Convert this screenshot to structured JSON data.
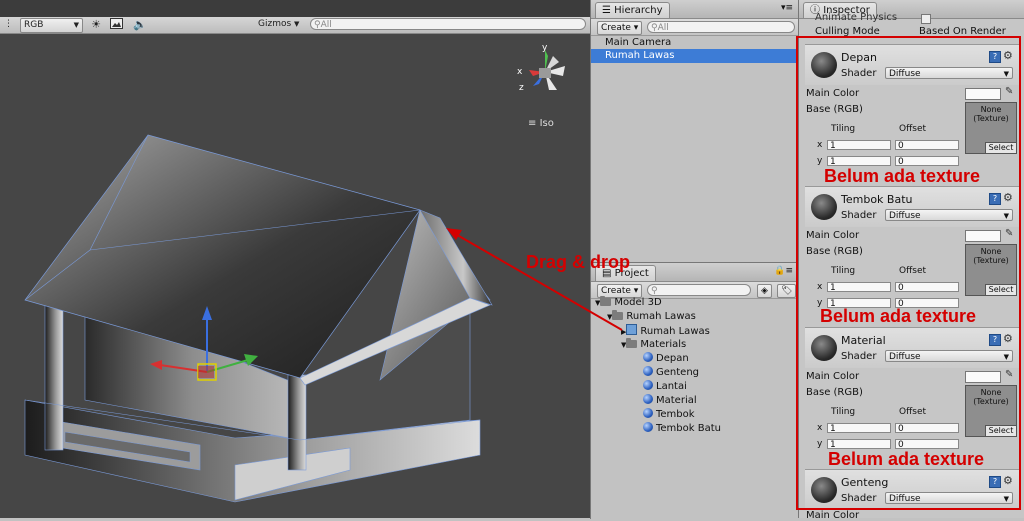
{
  "scene": {
    "render_mode": "RGB",
    "gizmos_label": "Gizmos",
    "search_placeholder": "All",
    "projection_label": "Iso",
    "axis_labels": {
      "x": "x",
      "y": "y",
      "z": "z"
    },
    "icons": [
      "sun-icon",
      "image-icon",
      "audio-icon"
    ]
  },
  "hierarchy": {
    "tab_label": "Hierarchy",
    "create_label": "Create",
    "search_placeholder": "All",
    "items": [
      {
        "label": "Main Camera",
        "selected": false
      },
      {
        "label": "Rumah Lawas",
        "selected": true
      }
    ]
  },
  "project": {
    "tab_label": "Project",
    "create_label": "Create",
    "tree": {
      "root": "Model 3D",
      "child_folder": "Rumah Lawas",
      "prefab": "Rumah Lawas",
      "materials_folder": "Materials",
      "materials": [
        "Depan",
        "Genteng",
        "Lantai",
        "Material",
        "Tembok",
        "Tembok Batu"
      ]
    }
  },
  "inspector": {
    "tab_label": "Inspector",
    "top_rows": [
      {
        "label": "Animate Physics",
        "value": ""
      },
      {
        "label": "Culling Mode",
        "value": "Based On Render"
      }
    ],
    "materials": [
      {
        "name": "Depan",
        "shader_label": "Shader",
        "shader": "Diffuse",
        "main_color": "Main Color",
        "base": "Base (RGB)",
        "tiling": "Tiling",
        "offset": "Offset",
        "tiling_x": "1",
        "tiling_y": "1",
        "offset_x": "0",
        "offset_y": "0",
        "texture_none": "None",
        "texture_type": "(Texture)",
        "select": "Select"
      },
      {
        "name": "Tembok Batu",
        "shader_label": "Shader",
        "shader": "Diffuse",
        "main_color": "Main Color",
        "base": "Base (RGB)",
        "tiling": "Tiling",
        "offset": "Offset",
        "tiling_x": "1",
        "tiling_y": "1",
        "offset_x": "0",
        "offset_y": "0",
        "texture_none": "None",
        "texture_type": "(Texture)",
        "select": "Select"
      },
      {
        "name": "Material",
        "shader_label": "Shader",
        "shader": "Diffuse",
        "main_color": "Main Color",
        "base": "Base (RGB)",
        "tiling": "Tiling",
        "offset": "Offset",
        "tiling_x": "1",
        "tiling_y": "1",
        "offset_x": "0",
        "offset_y": "0",
        "texture_none": "None",
        "texture_type": "(Texture)",
        "select": "Select"
      }
    ],
    "last_material": {
      "name": "Genteng",
      "shader_label": "Shader",
      "shader": "Diffuse",
      "next_row": "Main Color"
    },
    "axis_x": "x",
    "axis_y": "y"
  },
  "annotations": {
    "drag_drop": "Drag & drop",
    "no_texture": "Belum ada texture",
    "color": "#d40000"
  }
}
